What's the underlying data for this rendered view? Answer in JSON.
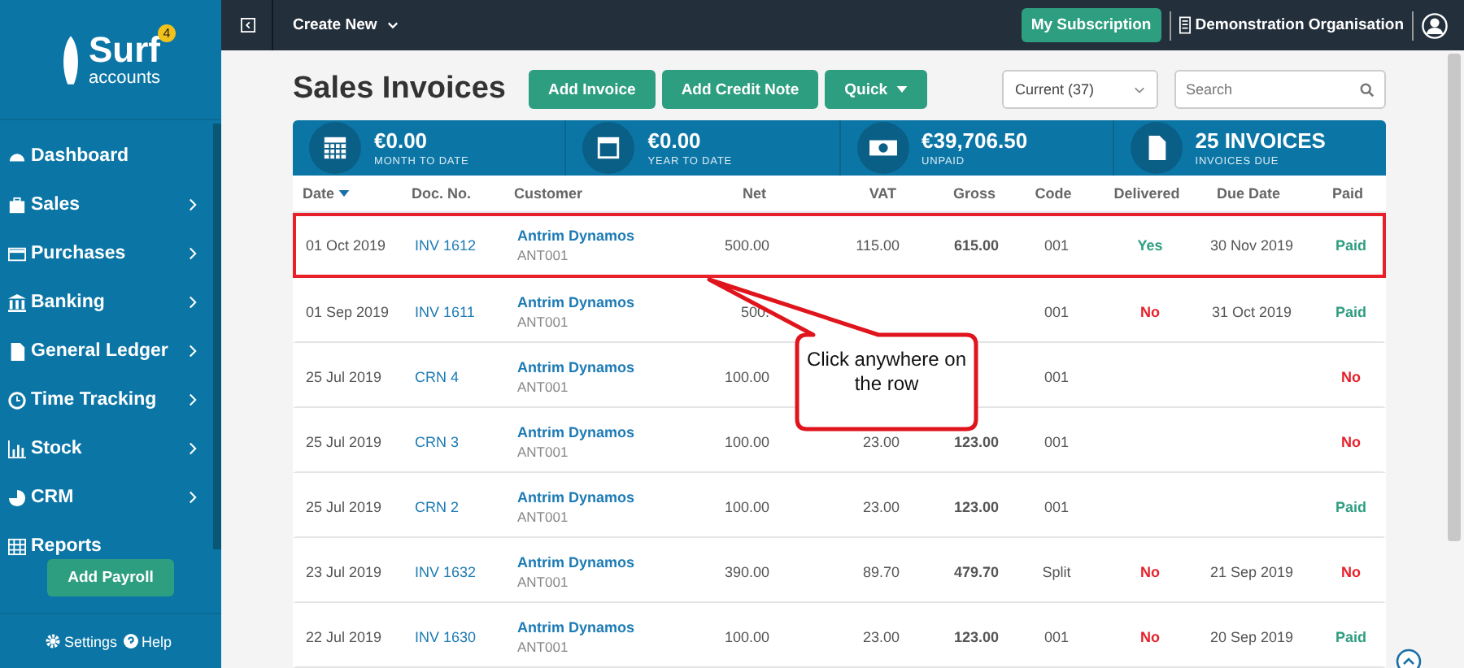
{
  "sidebar": {
    "logo": {
      "name": "Surf",
      "sub": "accounts",
      "badge": "4"
    },
    "items": [
      {
        "label": "Dashboard",
        "submenu": false
      },
      {
        "label": "Sales",
        "submenu": true
      },
      {
        "label": "Purchases",
        "submenu": true
      },
      {
        "label": "Banking",
        "submenu": true
      },
      {
        "label": "General Ledger",
        "submenu": true
      },
      {
        "label": "Time Tracking",
        "submenu": true
      },
      {
        "label": "Stock",
        "submenu": true
      },
      {
        "label": "CRM",
        "submenu": true
      },
      {
        "label": "Reports",
        "submenu": false
      }
    ],
    "payroll_button": "Add Payroll",
    "settings": "Settings",
    "help": "Help"
  },
  "topbar": {
    "create": "Create New",
    "subscription": "My Subscription",
    "organisation": "Demonstration Organisation"
  },
  "page": {
    "title": "Sales Invoices",
    "buttons": [
      "Add Invoice",
      "Add Credit Note"
    ],
    "quick": "Quick",
    "filter": "Current (37)",
    "search": {
      "placeholder": "Search"
    }
  },
  "stats": [
    {
      "value": "€0.00",
      "label": "MONTH TO DATE"
    },
    {
      "value": "€0.00",
      "label": "YEAR TO DATE"
    },
    {
      "value": "€39,706.50",
      "label": "UNPAID"
    },
    {
      "value": "25 INVOICES",
      "label": "INVOICES DUE"
    }
  ],
  "table": {
    "columns": [
      "Date",
      "Doc. No.",
      "Customer",
      "Net",
      "VAT",
      "Gross",
      "Code",
      "Delivered",
      "Due Date",
      "Paid"
    ],
    "rows": [
      {
        "highlighted": true,
        "date": "01 Oct 2019",
        "doc": "INV 1612",
        "customer": "Antrim Dynamos",
        "account": "ANT001",
        "net": "500.00",
        "vat": "115.00",
        "gross": "615.00",
        "code": "001",
        "delivered": {
          "text": "Yes",
          "ok": true
        },
        "due": "30 Nov 2019",
        "paid": {
          "text": "Paid",
          "ok": true
        }
      },
      {
        "highlighted": false,
        "date": "01 Sep 2019",
        "doc": "INV 1611",
        "customer": "Antrim Dynamos",
        "account": "ANT001",
        "net": "500.",
        "code": "001",
        "delivered": {
          "text": "No",
          "ok": false
        },
        "due": "31 Oct 2019",
        "paid": {
          "text": "Paid",
          "ok": true
        }
      },
      {
        "highlighted": false,
        "date": "25 Jul 2019",
        "doc": "CRN 4",
        "customer": "Antrim Dynamos",
        "account": "ANT001",
        "net": "100.00",
        "code": "001",
        "paid": {
          "text": "No",
          "ok": false
        }
      },
      {
        "highlighted": false,
        "date": "25 Jul 2019",
        "doc": "CRN 3",
        "customer": "Antrim Dynamos",
        "account": "ANT001",
        "net": "100.00",
        "vat": "23.00",
        "gross": "123.00",
        "code": "001",
        "paid": {
          "text": "No",
          "ok": false
        }
      },
      {
        "highlighted": false,
        "date": "25 Jul 2019",
        "doc": "CRN 2",
        "customer": "Antrim Dynamos",
        "account": "ANT001",
        "net": "100.00",
        "vat": "23.00",
        "gross": "123.00",
        "code": "001",
        "paid": {
          "text": "Paid",
          "ok": true
        }
      },
      {
        "highlighted": false,
        "date": "23 Jul 2019",
        "doc": "INV 1632",
        "customer": "Antrim Dynamos",
        "account": "ANT001",
        "net": "390.00",
        "vat": "89.70",
        "gross": "479.70",
        "code": "Split",
        "delivered": {
          "text": "No",
          "ok": false
        },
        "due": "21 Sep 2019",
        "paid": {
          "text": "No",
          "ok": false
        }
      },
      {
        "highlighted": false,
        "date": "22 Jul 2019",
        "doc": "INV 1630",
        "customer": "Antrim Dynamos",
        "account": "ANT001",
        "net": "100.00",
        "vat": "23.00",
        "gross": "123.00",
        "code": "001",
        "delivered": {
          "text": "No",
          "ok": false
        },
        "due": "20 Sep 2019",
        "paid": {
          "text": "Paid",
          "ok": true
        }
      }
    ]
  },
  "callout": "Click anywhere on the row"
}
